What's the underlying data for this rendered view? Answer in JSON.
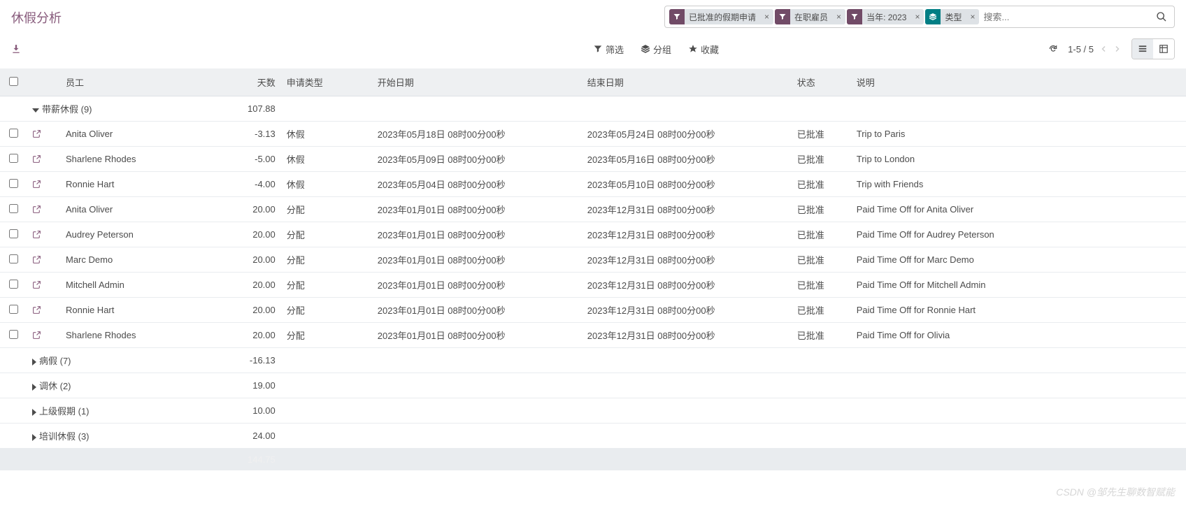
{
  "header": {
    "title": "休假分析",
    "search_placeholder": "搜索...",
    "facets": [
      {
        "icon": "filter",
        "label": "已批准的假期申请"
      },
      {
        "icon": "filter",
        "label": "在职雇员"
      },
      {
        "icon": "filter",
        "label": "当年: 2023"
      },
      {
        "icon": "group",
        "label": "类型"
      }
    ],
    "filter_label": "筛选",
    "group_label": "分组",
    "favorite_label": "收藏",
    "pager_text": "1-5 / 5"
  },
  "columns": {
    "employee": "员工",
    "days": "天数",
    "req_type": "申请类型",
    "start": "开始日期",
    "end": "结束日期",
    "status": "状态",
    "desc": "说明"
  },
  "groups": [
    {
      "expanded": true,
      "name": "带薪休假",
      "count": "(9)",
      "total": "107.88",
      "rows": [
        {
          "emp": "Anita Oliver",
          "days": "-3.13",
          "type": "休假",
          "start": "2023年05月18日 08时00分00秒",
          "end": "2023年05月24日 08时00分00秒",
          "status": "已批准",
          "desc": "Trip to Paris"
        },
        {
          "emp": "Sharlene Rhodes",
          "days": "-5.00",
          "type": "休假",
          "start": "2023年05月09日 08时00分00秒",
          "end": "2023年05月16日 08时00分00秒",
          "status": "已批准",
          "desc": "Trip to London"
        },
        {
          "emp": "Ronnie Hart",
          "days": "-4.00",
          "type": "休假",
          "start": "2023年05月04日 08时00分00秒",
          "end": "2023年05月10日 08时00分00秒",
          "status": "已批准",
          "desc": "Trip with Friends"
        },
        {
          "emp": "Anita Oliver",
          "days": "20.00",
          "type": "分配",
          "start": "2023年01月01日 08时00分00秒",
          "end": "2023年12月31日 08时00分00秒",
          "status": "已批准",
          "desc": "Paid Time Off for Anita Oliver"
        },
        {
          "emp": "Audrey Peterson",
          "days": "20.00",
          "type": "分配",
          "start": "2023年01月01日 08时00分00秒",
          "end": "2023年12月31日 08时00分00秒",
          "status": "已批准",
          "desc": "Paid Time Off for Audrey Peterson"
        },
        {
          "emp": "Marc Demo",
          "days": "20.00",
          "type": "分配",
          "start": "2023年01月01日 08时00分00秒",
          "end": "2023年12月31日 08时00分00秒",
          "status": "已批准",
          "desc": "Paid Time Off for Marc Demo"
        },
        {
          "emp": "Mitchell Admin",
          "days": "20.00",
          "type": "分配",
          "start": "2023年01月01日 08时00分00秒",
          "end": "2023年12月31日 08时00分00秒",
          "status": "已批准",
          "desc": "Paid Time Off for Mitchell Admin"
        },
        {
          "emp": "Ronnie Hart",
          "days": "20.00",
          "type": "分配",
          "start": "2023年01月01日 08时00分00秒",
          "end": "2023年12月31日 08时00分00秒",
          "status": "已批准",
          "desc": "Paid Time Off for Ronnie Hart"
        },
        {
          "emp": "Sharlene Rhodes",
          "days": "20.00",
          "type": "分配",
          "start": "2023年01月01日 08时00分00秒",
          "end": "2023年12月31日 08时00分00秒",
          "status": "已批准",
          "desc": "Paid Time Off for Olivia"
        }
      ]
    },
    {
      "expanded": false,
      "name": "病假",
      "count": "(7)",
      "total": "-16.13"
    },
    {
      "expanded": false,
      "name": "调休",
      "count": "(2)",
      "total": "19.00"
    },
    {
      "expanded": false,
      "name": "上级假期",
      "count": "(1)",
      "total": "10.00"
    },
    {
      "expanded": false,
      "name": "培训休假",
      "count": "(3)",
      "total": "24.00"
    }
  ],
  "footer_total": "144.75",
  "watermark": "CSDN @邹先生聊数智赋能"
}
